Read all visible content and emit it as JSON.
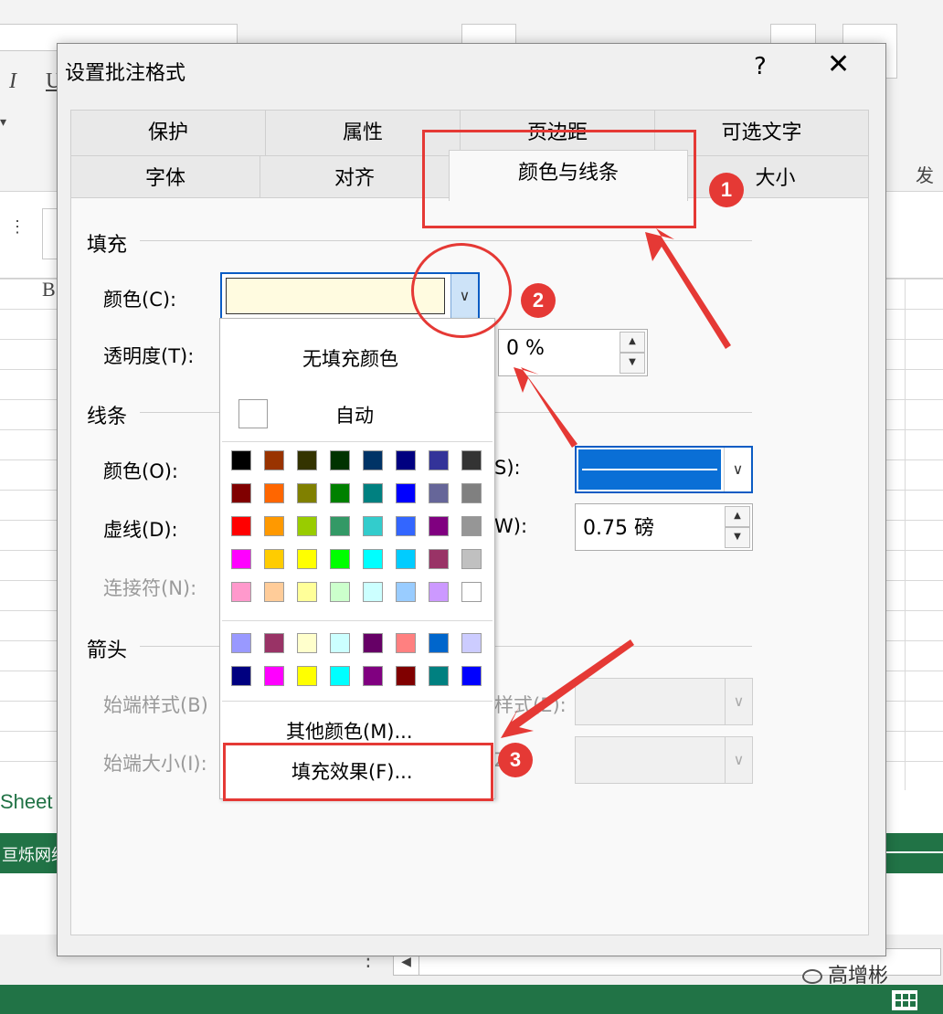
{
  "background": {
    "sheet_tab": "Sheet",
    "status_text": "亘烁网络",
    "watermark": "高增彬",
    "col_label": "B"
  },
  "dialog": {
    "title": "设置批注格式",
    "help": "?",
    "close": "✕",
    "tabs_row1": [
      "保护",
      "属性",
      "页边距",
      "可选文字"
    ],
    "tabs_row2": [
      "字体",
      "对齐",
      "颜色与线条",
      "大小"
    ],
    "active_tab": "颜色与线条"
  },
  "fill": {
    "section": "填充",
    "color_label": "颜色(C):",
    "color_value": "#fffbe0",
    "transparency_label": "透明度(T):",
    "transparency_value": "0 %"
  },
  "line": {
    "section": "线条",
    "color_label": "颜色(O):",
    "dash_label": "虚线(D):",
    "connector_label": "连接符(N):",
    "style_label_tail": "S):",
    "weight_label_tail": "W):",
    "weight_value": "0.75 磅",
    "line_color": "#0a6fd6"
  },
  "arrows": {
    "section": "箭头",
    "begin_style_label": "始端样式(B)",
    "begin_size_label": "始端大小(I):",
    "end_style_tail": "样式(E):",
    "end_size_tail": "Z):"
  },
  "popup": {
    "no_fill": "无填充颜色",
    "auto": "自动",
    "more_colors": "其他颜色(M)...",
    "fill_effects": "填充效果(F)...",
    "palette_main": [
      [
        "#000000",
        "#993300",
        "#333300",
        "#003300",
        "#003366",
        "#000080",
        "#333399",
        "#333333"
      ],
      [
        "#800000",
        "#ff6600",
        "#808000",
        "#008000",
        "#008080",
        "#0000ff",
        "#666699",
        "#808080"
      ],
      [
        "#ff0000",
        "#ff9900",
        "#99cc00",
        "#339966",
        "#33cccc",
        "#3366ff",
        "#800080",
        "#969696"
      ],
      [
        "#ff00ff",
        "#ffcc00",
        "#ffff00",
        "#00ff00",
        "#00ffff",
        "#00ccff",
        "#993366",
        "#c0c0c0"
      ],
      [
        "#ff99cc",
        "#ffcc99",
        "#ffff99",
        "#ccffcc",
        "#ccffff",
        "#99ccff",
        "#cc99ff",
        "#ffffff"
      ]
    ],
    "palette_extra": [
      [
        "#9999ff",
        "#993366",
        "#ffffcc",
        "#ccffff",
        "#660066",
        "#ff8080",
        "#0066cc",
        "#ccccff"
      ],
      [
        "#000080",
        "#ff00ff",
        "#ffff00",
        "#00ffff",
        "#800080",
        "#800000",
        "#008080",
        "#0000ff"
      ]
    ]
  },
  "annotations": {
    "badges": [
      "1",
      "2",
      "3"
    ],
    "color": "#e53935"
  }
}
